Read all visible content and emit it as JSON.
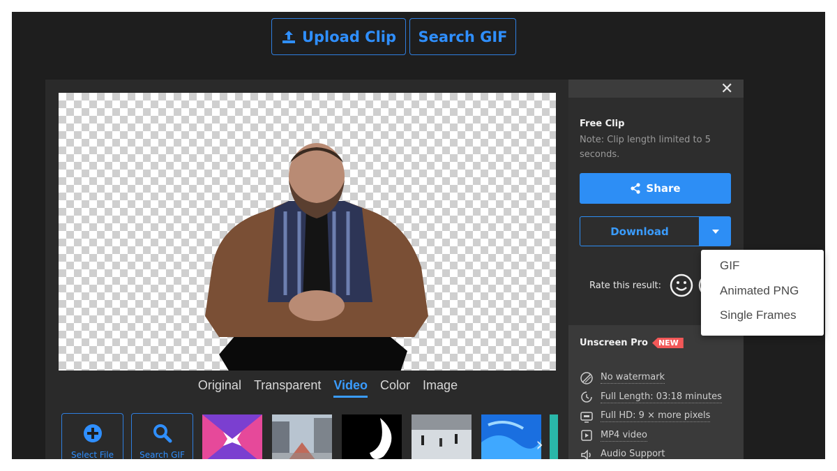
{
  "header": {
    "upload_label": "Upload Clip",
    "search_gif_label": "Search GIF"
  },
  "view_tabs": [
    {
      "label": "Original",
      "active": false
    },
    {
      "label": "Transparent",
      "active": false
    },
    {
      "label": "Video",
      "active": true
    },
    {
      "label": "Color",
      "active": false
    },
    {
      "label": "Image",
      "active": false
    }
  ],
  "thumb_strip": {
    "select_file_label": "Select File",
    "search_gif_label": "Search GIF"
  },
  "sidebar": {
    "free_title": "Free Clip",
    "free_note": "Note: Clip length limited to 5 seconds.",
    "share_label": "Share",
    "download_label": "Download",
    "rate_label": "Rate this result:",
    "pro_title": "Unscreen Pro",
    "new_badge": "NEW",
    "features": [
      {
        "label": "No watermark",
        "icon": "no-watermark-icon"
      },
      {
        "label": "Full Length: 03:18 minutes",
        "icon": "clock-icon"
      },
      {
        "label": "Full HD: 9 × more pixels",
        "icon": "hd-icon"
      },
      {
        "label": "MP4 video",
        "icon": "play-icon"
      },
      {
        "label": "Audio Support",
        "icon": "speaker-icon"
      }
    ]
  },
  "download_menu": {
    "items": [
      "GIF",
      "Animated PNG",
      "Single Frames"
    ]
  },
  "colors": {
    "accent": "#2d8ef5",
    "background": "#1e1e1e",
    "badge": "#f25858"
  }
}
